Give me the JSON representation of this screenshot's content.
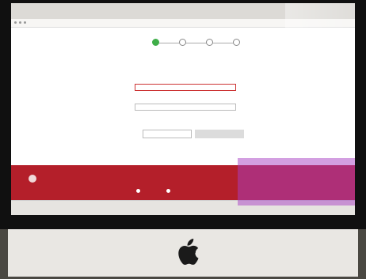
{
  "browser": {
    "tabs": [
      "",
      "",
      "",
      "",
      "",
      "",
      "",
      ""
    ],
    "address": ""
  },
  "wizard": {
    "steps": [
      {
        "label": "",
        "state": "done"
      },
      {
        "label": "",
        "state": "pending"
      },
      {
        "label": "",
        "state": "pending"
      },
      {
        "label": "",
        "state": "pending"
      }
    ]
  },
  "form": {
    "section_title": "",
    "info_text": "",
    "email_label": "",
    "email_value": "",
    "email_error": "",
    "otp_label": "",
    "otp_placeholder": "",
    "otp_hint": "",
    "resend_link": "",
    "back_button": "",
    "next_button": ""
  },
  "page_footer_link": "",
  "red_footer": {
    "org_name_line1": "",
    "org_name_line2": "",
    "org_subtitle": "",
    "contact_text": "",
    "contact_phone": "",
    "contact_email": ""
  },
  "downloads": [
    "",
    "",
    "",
    "",
    "",
    "",
    ""
  ],
  "colors": {
    "step_done": "#3fae49",
    "footer": "#b41f2a",
    "error": "#c0272d"
  }
}
